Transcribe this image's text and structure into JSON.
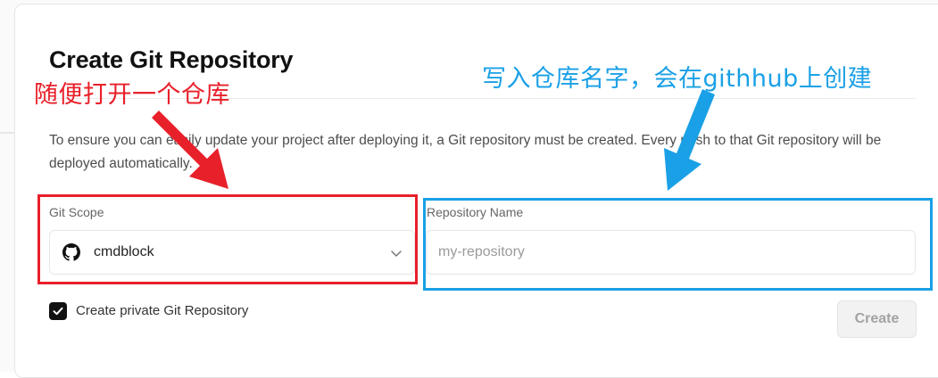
{
  "dialog": {
    "title": "Create Git Repository",
    "description": "To ensure you can easily update your project after deploying it, a Git repository must be created. Every push to that Git repository will be deployed automatically."
  },
  "git_scope": {
    "label": "Git Scope",
    "selected_value": "cmdblock",
    "icon": "github-icon"
  },
  "repository_name": {
    "label": "Repository Name",
    "placeholder": "my-repository",
    "value": ""
  },
  "private_checkbox": {
    "label": "Create private Git Repository",
    "checked": true
  },
  "create_button": {
    "label": "Create"
  },
  "annotations": {
    "red_note": "随便打开一个仓库",
    "blue_note": "写入仓库名字，会在githhub上创建",
    "red_color": "#e8202a",
    "blue_color": "#1aa0e6"
  }
}
